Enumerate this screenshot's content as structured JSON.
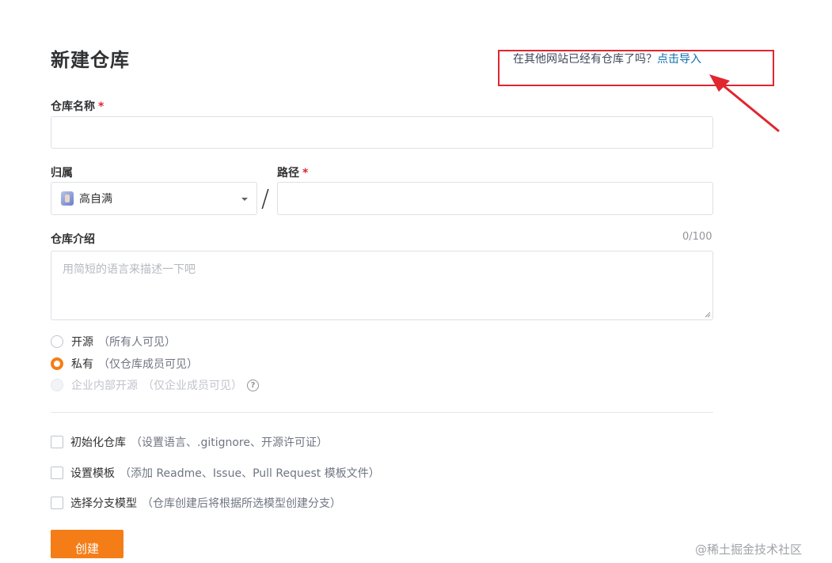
{
  "page": {
    "title": "新建仓库"
  },
  "import_hint": {
    "text": "在其他网站已经有仓库了吗？",
    "link": "点击导入"
  },
  "repo_name": {
    "label": "仓库名称",
    "required_mark": "*",
    "value": ""
  },
  "owner": {
    "label": "归属",
    "selected": "高自满"
  },
  "separator": "/",
  "path": {
    "label": "路径",
    "required_mark": "*",
    "value": ""
  },
  "description": {
    "label": "仓库介绍",
    "counter": "0/100",
    "placeholder": "用简短的语言来描述一下吧"
  },
  "visibility": {
    "options": [
      {
        "label": "开源",
        "note": "（所有人可见）",
        "checked": false,
        "disabled": false
      },
      {
        "label": "私有",
        "note": "（仅仓库成员可见）",
        "checked": true,
        "disabled": false
      },
      {
        "label": "企业内部开源",
        "note": "（仅企业成员可见）",
        "checked": false,
        "disabled": true
      }
    ],
    "help_icon": "?"
  },
  "options": [
    {
      "label": "初始化仓库",
      "note": "（设置语言、.gitignore、开源许可证）",
      "checked": false
    },
    {
      "label": "设置模板",
      "note": "（添加 Readme、Issue、Pull Request 模板文件）",
      "checked": false
    },
    {
      "label": "选择分支模型",
      "note": "（仓库创建后将根据所选模型创建分支）",
      "checked": false
    }
  ],
  "create_button": "创建",
  "watermark": "@稀土掘金技术社区",
  "colors": {
    "accent": "#f57d17",
    "link": "#0f6fb0",
    "annotation": "#e0262f"
  }
}
